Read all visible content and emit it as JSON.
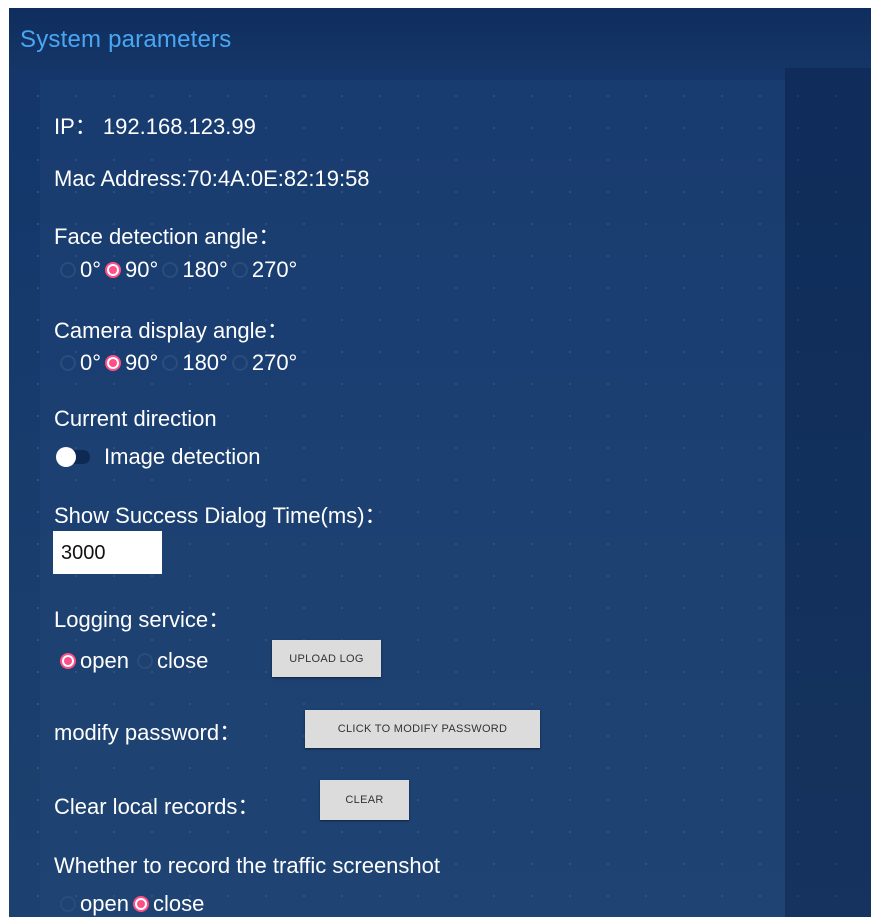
{
  "header": {
    "title": "System parameters"
  },
  "ip": {
    "label": "IP：",
    "value": "192.168.123.99"
  },
  "mac": {
    "text": "Mac Address:70:4A:0E:82:19:58"
  },
  "face_detection": {
    "label": "Face detection angle：",
    "options": [
      "0°",
      "90°",
      "180°",
      "270°"
    ],
    "selected": "90°"
  },
  "camera_display": {
    "label": "Camera display angle：",
    "options": [
      "0°",
      "90°",
      "180°",
      "270°"
    ],
    "selected": "90°"
  },
  "current_direction": {
    "label": "Current direction",
    "toggle_label": "Image detection",
    "toggle_on": false
  },
  "success_dialog": {
    "label": "Show Success Dialog Time(ms)：",
    "value": "3000"
  },
  "logging": {
    "label": "Logging service：",
    "options": [
      "open",
      "close"
    ],
    "selected": "open",
    "upload_button": "UPLOAD LOG"
  },
  "modify_password": {
    "label": "modify password：",
    "button": "CLICK TO MODIFY PASSWORD"
  },
  "clear_records": {
    "label": "Clear local records：",
    "button": "CLEAR"
  },
  "traffic_screenshot": {
    "label": "Whether to record the traffic screenshot",
    "options": [
      "open",
      "close"
    ],
    "selected": "close"
  },
  "colors": {
    "accent_radio": "#ff4f86",
    "header_title": "#4aa6f2",
    "background": "#163a6c"
  }
}
